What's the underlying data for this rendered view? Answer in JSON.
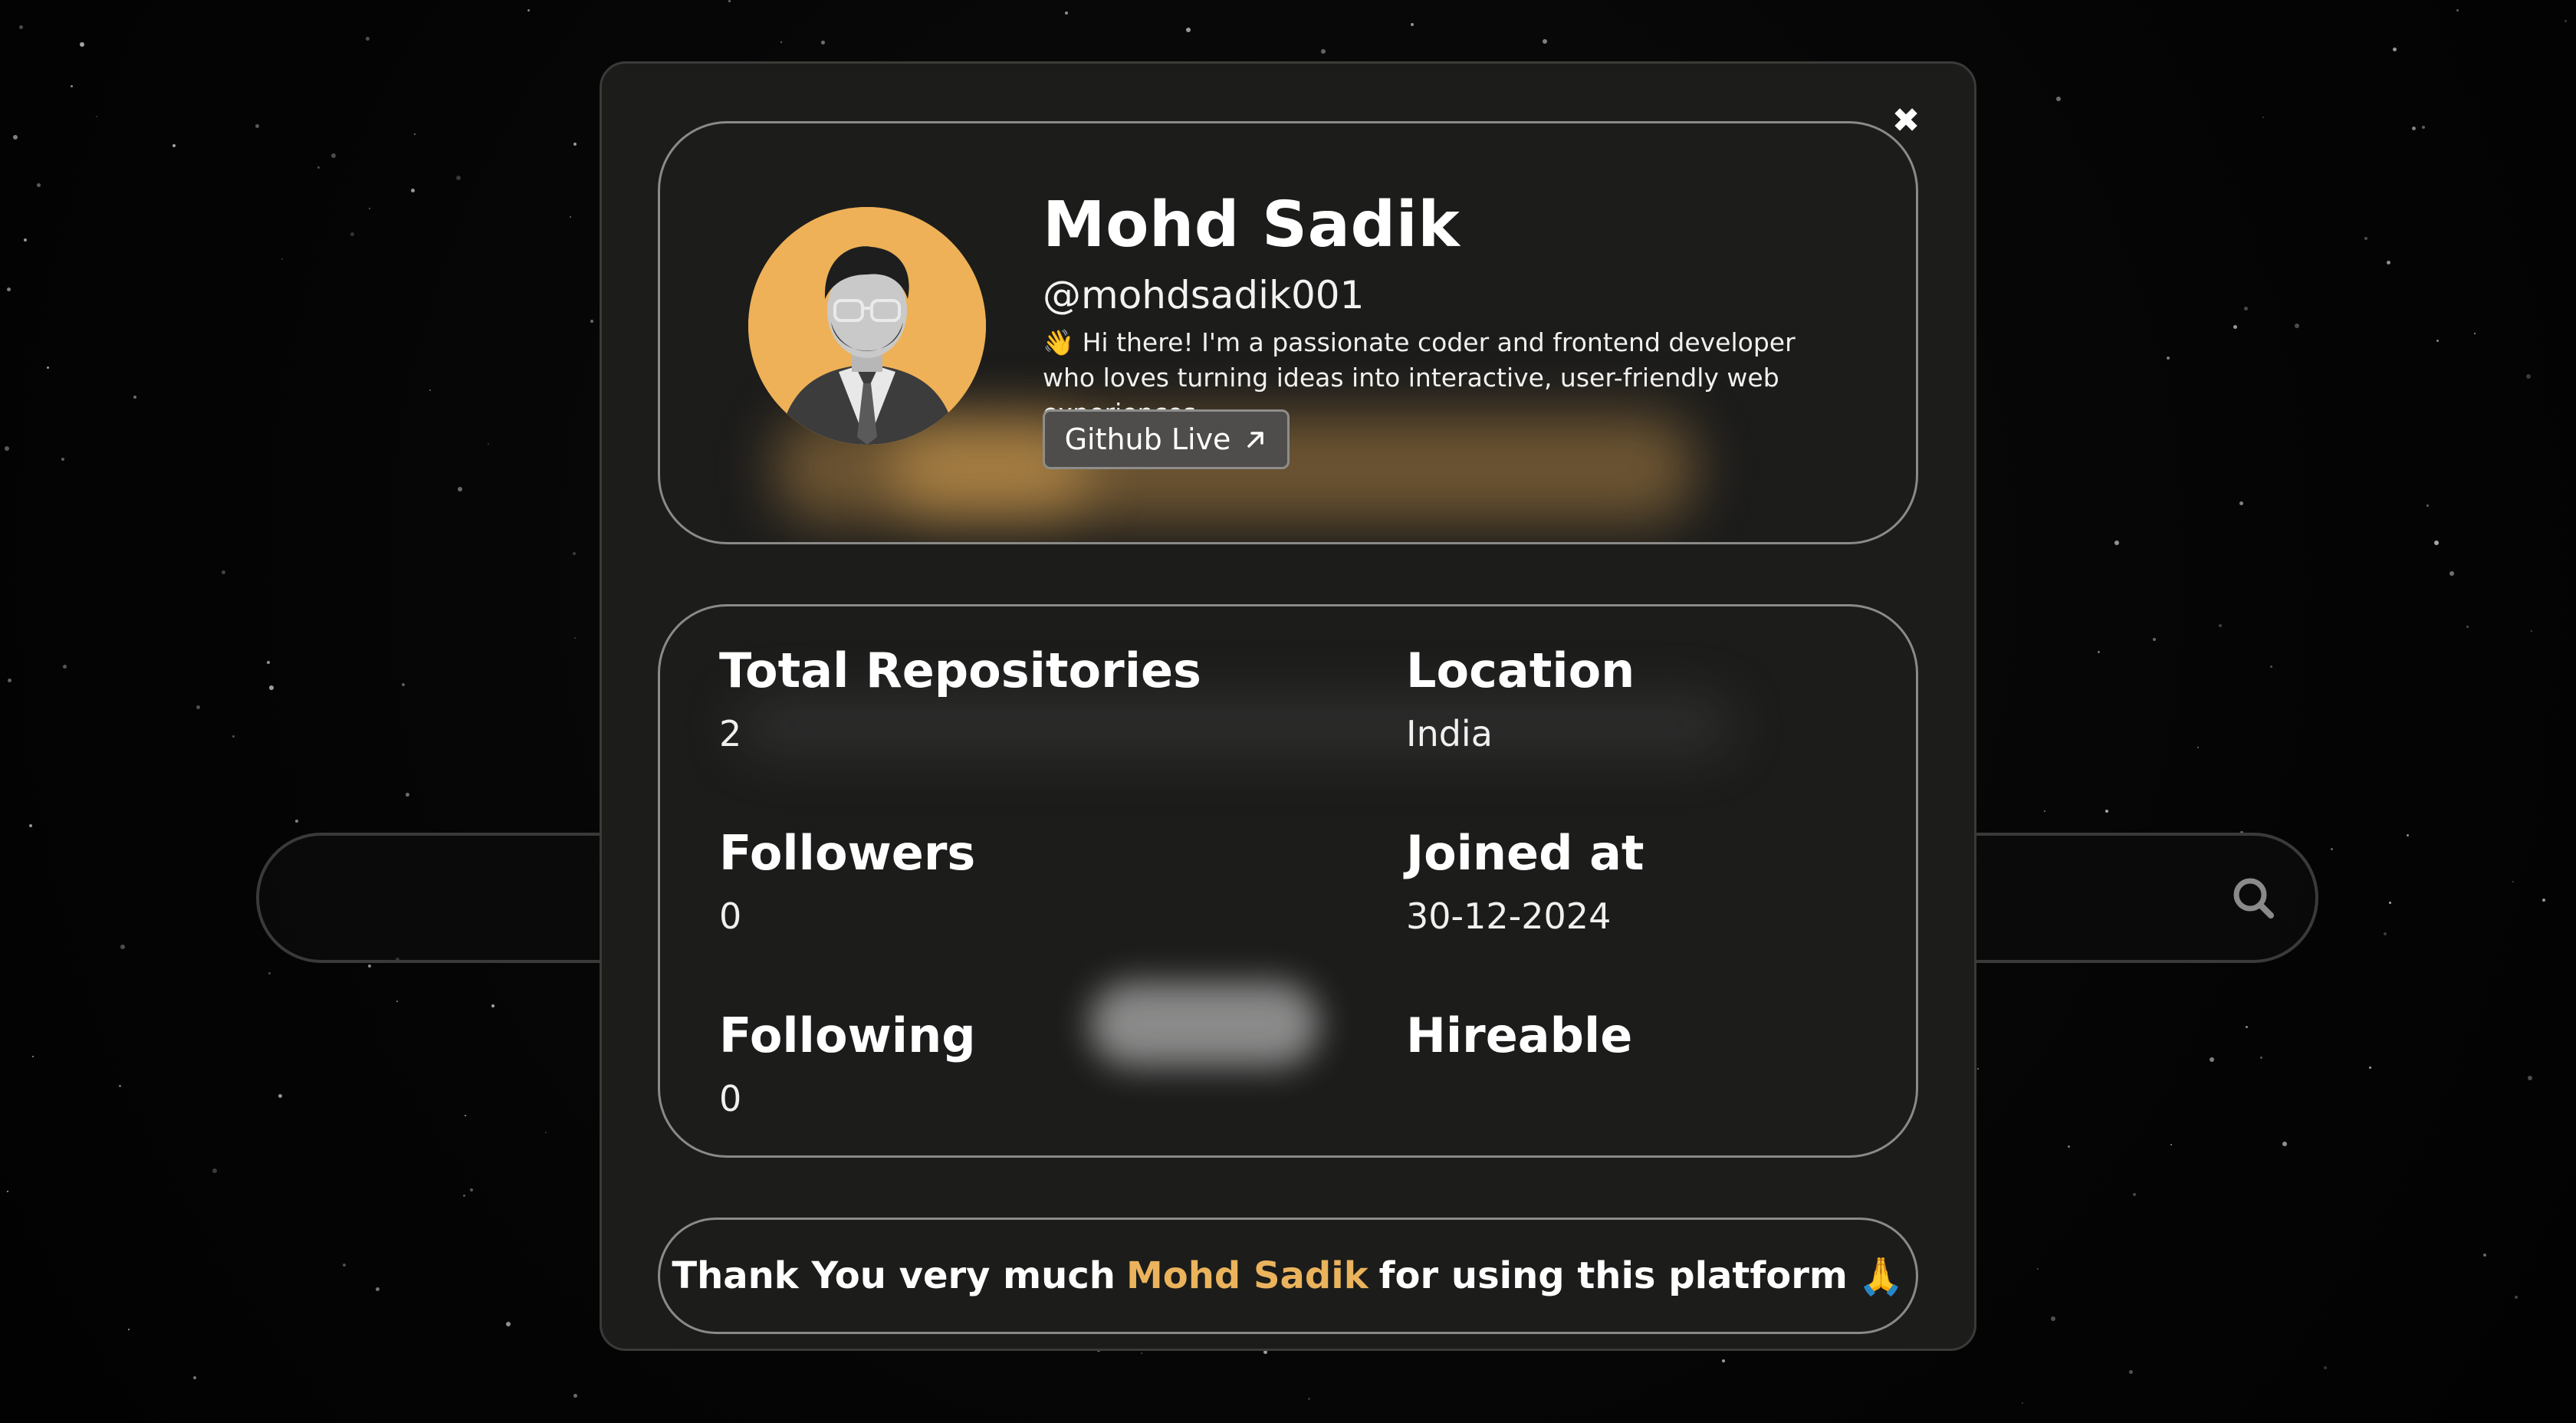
{
  "modal": {
    "close_icon": "close-icon"
  },
  "profile": {
    "name": "Mohd Sadik",
    "handle": "@mohdsadik001",
    "bio_emoji": "👋",
    "bio": "Hi there! I'm a passionate coder and frontend developer who loves turning ideas into interactive, user-friendly web experiences.",
    "github_button_label": "Github Live",
    "github_button_icon": "arrow-up-right-icon",
    "avatar_icon": "avatar",
    "accent_color": "#eeb157"
  },
  "stats": {
    "total_repositories_label": "Total Repositories",
    "total_repositories_value": "2",
    "location_label": "Location",
    "location_value": "India",
    "followers_label": "Followers",
    "followers_value": "0",
    "joined_label": "Joined at",
    "joined_value": "30-12-2024",
    "following_label": "Following",
    "following_value": "0",
    "hireable_label": "Hireable"
  },
  "thanks": {
    "prefix": "Thank You very much",
    "name": "Mohd Sadik",
    "suffix": "for using this platform",
    "emoji": "🙏"
  },
  "search": {
    "icon": "search-icon"
  }
}
